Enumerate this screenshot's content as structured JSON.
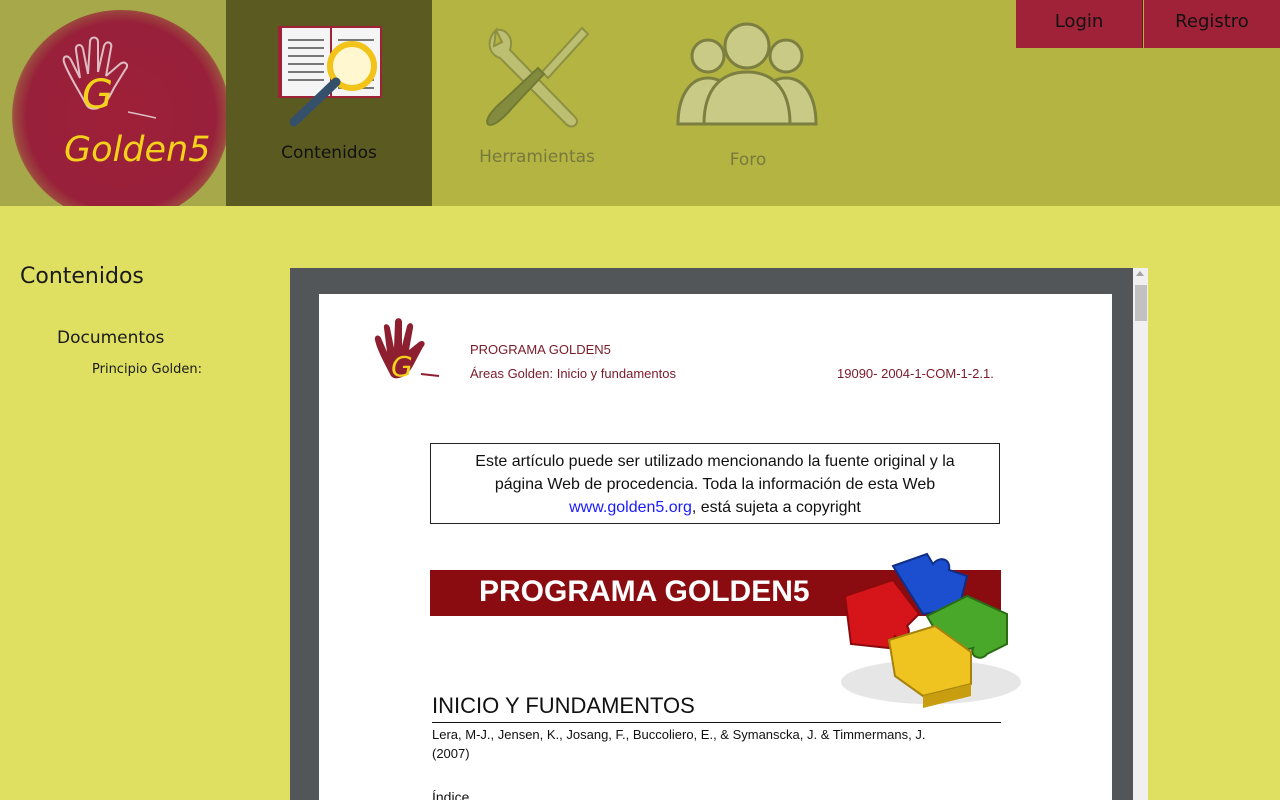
{
  "brand": {
    "logo_text": "Golden5"
  },
  "nav": {
    "contenidos": "Contenidos",
    "herramientas": "Herramientas",
    "foro": "Foro"
  },
  "auth": {
    "login": "Login",
    "registro": "Registro"
  },
  "sidebar": {
    "title": "Contenidos",
    "section": "Documentos",
    "items": [
      {
        "label": "Principio Golden:"
      }
    ]
  },
  "document": {
    "header_title": "PROGRAMA GOLDEN5",
    "header_subtitle": "Áreas Golden: Inicio y fundamentos",
    "header_code": "19090- 2004-1-COM-1-2.1.",
    "notice_line1": "Este artículo puede ser utilizado mencionando la fuente original y la",
    "notice_line2": "página Web de procedencia. Toda la información de esta Web",
    "notice_link": "www.golden5.org",
    "notice_line3_rest": ", está sujeta a copyright",
    "banner": "PROGRAMA GOLDEN5",
    "section_title": "INICIO Y FUNDAMENTOS",
    "authors_line1": "Lera, M-J., Jensen, K., Josang, F., Buccoliero, E., & Symanscka, J. & Timmermans, J.",
    "authors_line2": "(2007)",
    "index_heading": "Índice"
  },
  "colors": {
    "page_bg": "#dfe062",
    "topbar_bg": "#b4b443",
    "active_tab_bg": "#5b5a21",
    "brand_red": "#a02238",
    "logo_text": "#f4d11a",
    "banner_red": "#8a0c10"
  },
  "icons": {
    "contenidos": "book-magnifier-icon",
    "herramientas": "wrench-screwdriver-icon",
    "foro": "people-group-icon"
  }
}
